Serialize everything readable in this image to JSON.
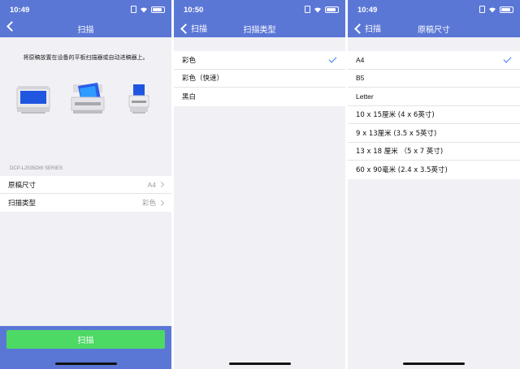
{
  "screen1": {
    "time": "10:49",
    "title": "扫描",
    "instruction": "将原稿放置在设备的平板扫描器或自动进稿器上。",
    "series": "DCP-L2535DW SERIES",
    "rows": [
      {
        "label": "原稿尺寸",
        "value": "A4"
      },
      {
        "label": "扫描类型",
        "value": "彩色"
      }
    ],
    "scan_button": "扫描",
    "icons": [
      "flatbed-scanner-icon",
      "mfp-printer-icon",
      "feeder-scanner-icon"
    ]
  },
  "screen2": {
    "time": "10:50",
    "back": "扫描",
    "title": "扫描类型",
    "items": [
      {
        "label": "彩色",
        "selected": true
      },
      {
        "label": "彩色（快速）",
        "selected": false
      },
      {
        "label": "黑白",
        "selected": false
      }
    ]
  },
  "screen3": {
    "time": "10:49",
    "back": "扫描",
    "title": "原稿尺寸",
    "items": [
      {
        "label": "A4",
        "selected": true
      },
      {
        "label": "B5",
        "selected": false
      },
      {
        "label": "Letter",
        "selected": false
      },
      {
        "label": "10 x 15厘米 (4 x 6英寸)",
        "selected": false
      },
      {
        "label": "9 x 13厘米 (3.5 x 5英寸)",
        "selected": false
      },
      {
        "label": "13 x 18 厘米 （5 x 7 英寸)",
        "selected": false
      },
      {
        "label": "60 x 90毫米 (2.4 x 3.5英寸)",
        "selected": false
      }
    ]
  },
  "colors": {
    "nav": "#5b77d6",
    "scan_button": "#4cd964",
    "check": "#3478f6",
    "background": "#f0f0f5"
  }
}
